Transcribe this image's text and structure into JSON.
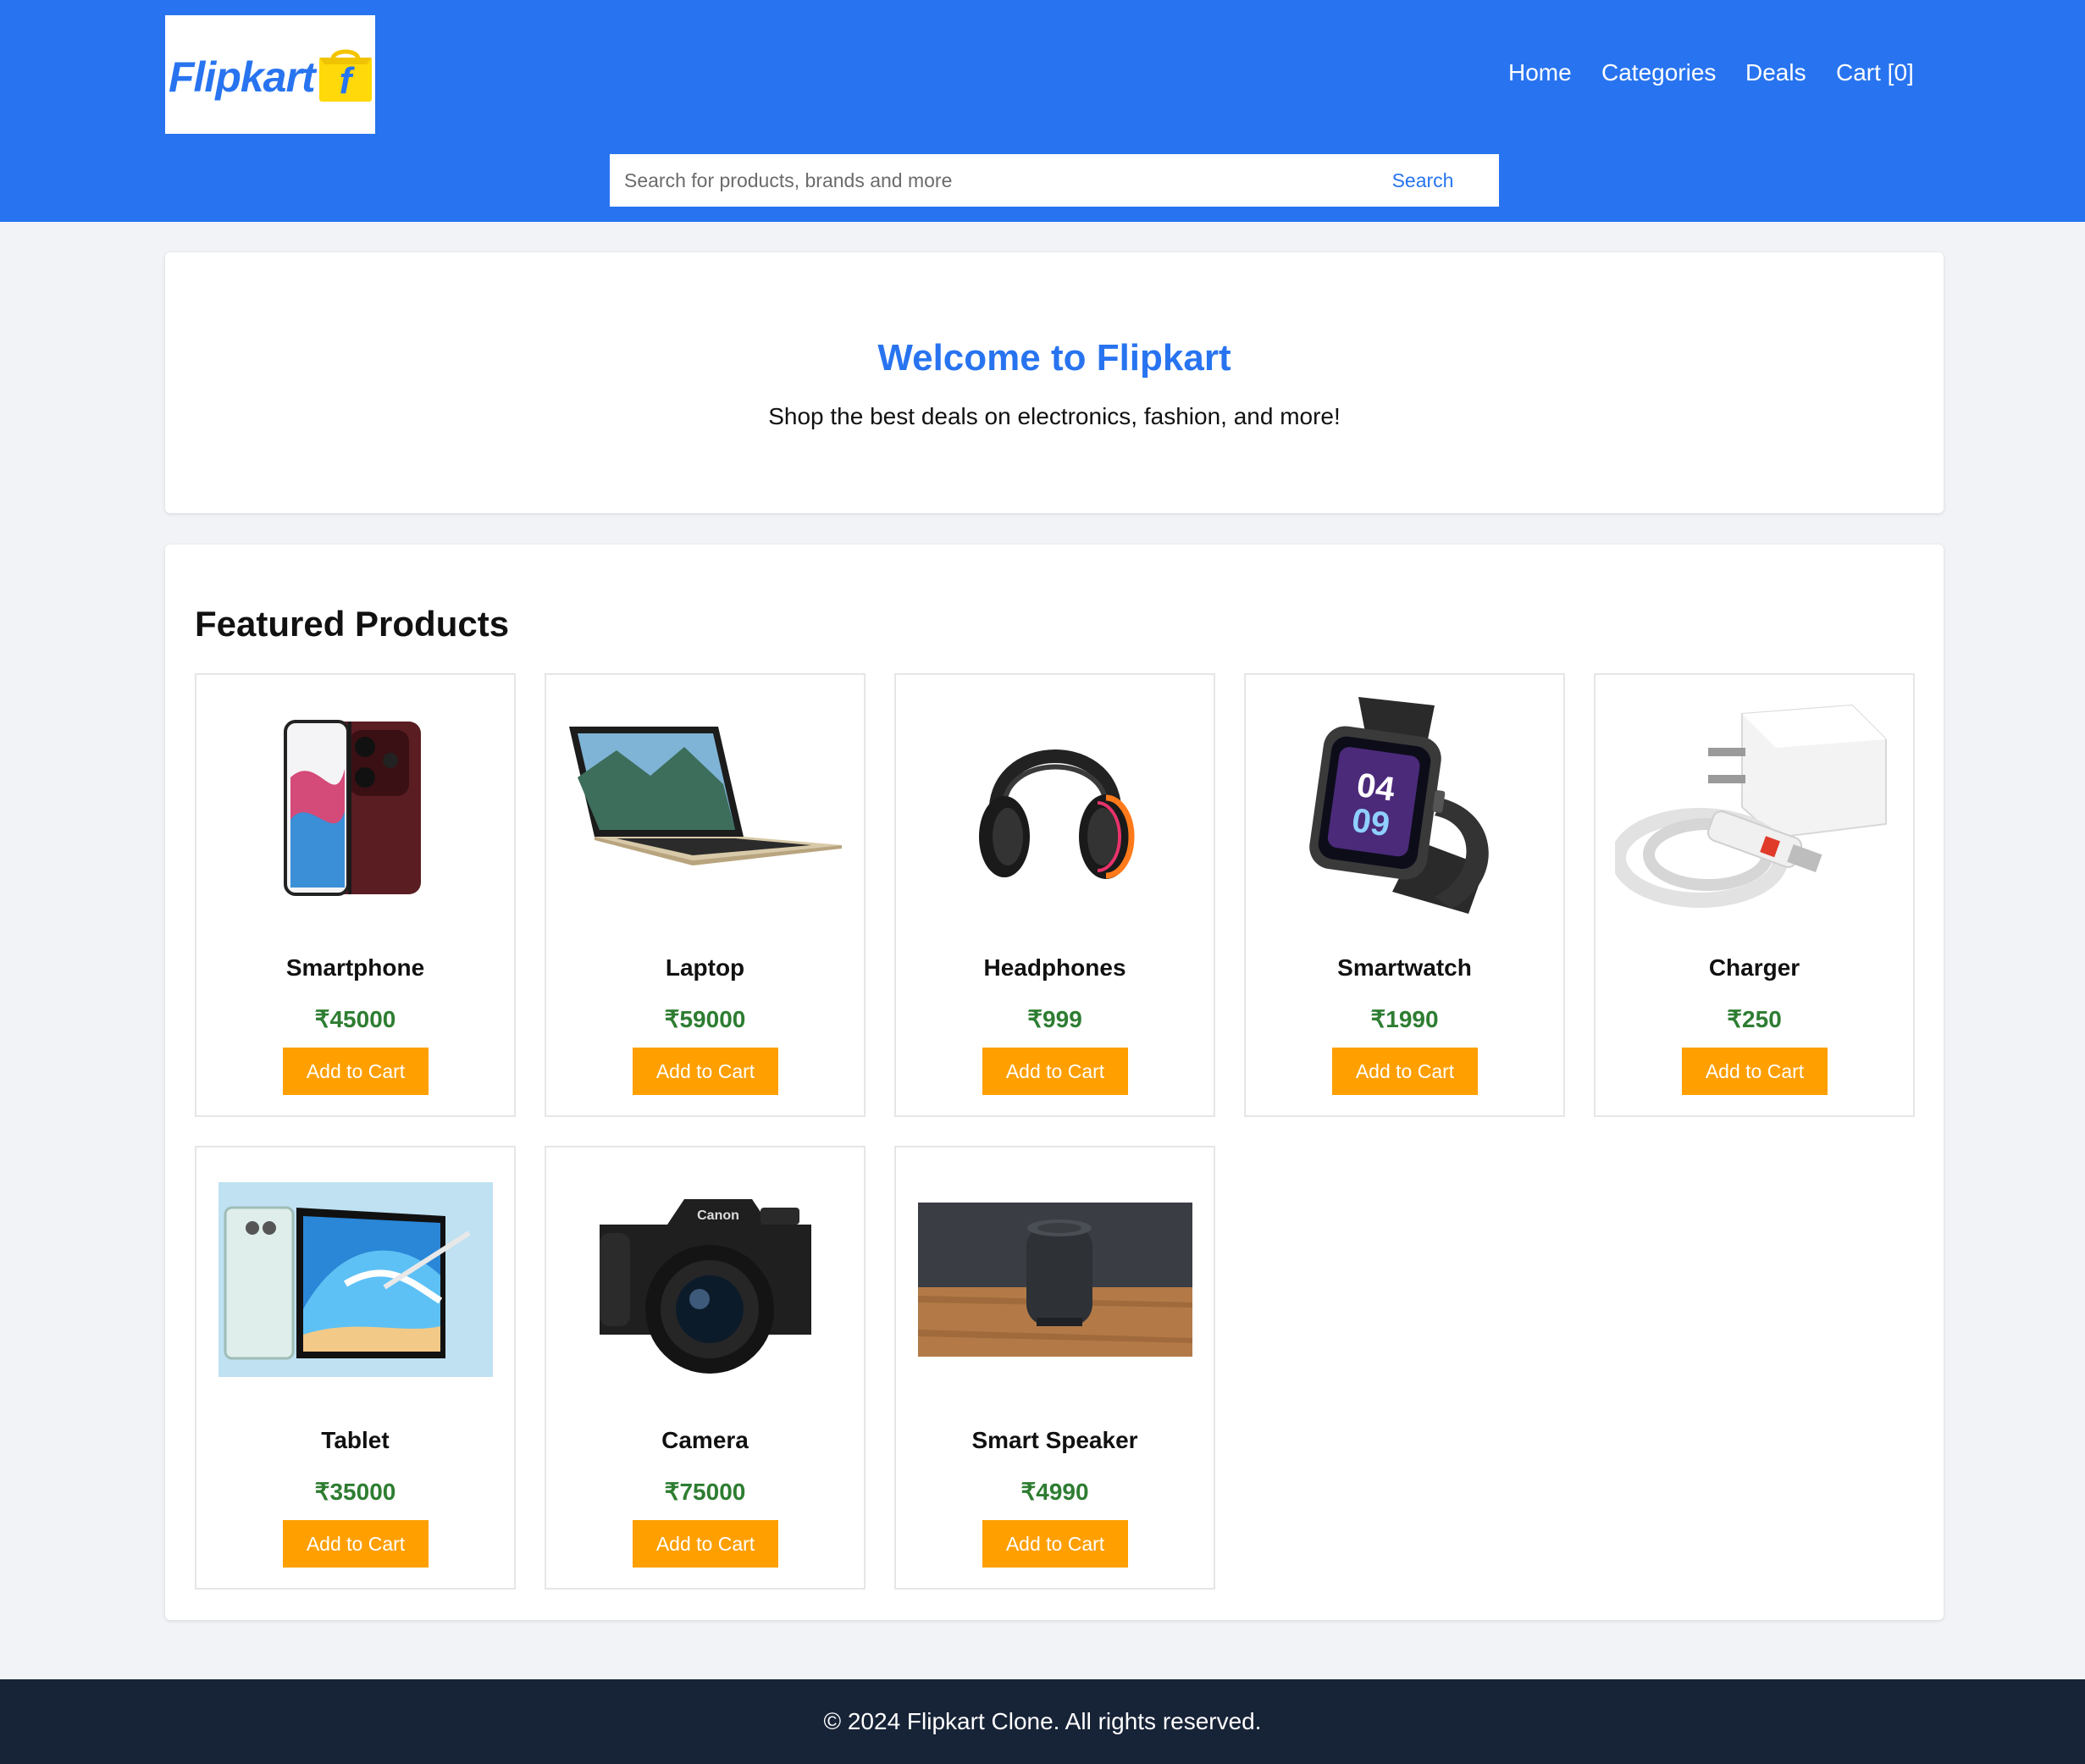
{
  "brand": {
    "logo_text": "Flipkart",
    "logo_mark": "f",
    "primary_color": "#2874f0",
    "accent_color": "#ff9f00",
    "price_color": "#2e7d32"
  },
  "nav": {
    "home": "Home",
    "categories": "Categories",
    "deals": "Deals",
    "cart": "Cart [0]"
  },
  "search": {
    "placeholder": "Search for products, brands and more",
    "value": "",
    "button": "Search"
  },
  "hero": {
    "title": "Welcome to Flipkart",
    "subtitle": "Shop the best deals on electronics, fashion, and more!"
  },
  "featured": {
    "heading": "Featured Products",
    "products": [
      {
        "name": "Smartphone",
        "price": "₹45000",
        "button": "Add to Cart",
        "image_icon": "smartphone-image"
      },
      {
        "name": "Laptop",
        "price": "₹59000",
        "button": "Add to Cart",
        "image_icon": "laptop-image"
      },
      {
        "name": "Headphones",
        "price": "₹999",
        "button": "Add to Cart",
        "image_icon": "headphones-image"
      },
      {
        "name": "Smartwatch",
        "price": "₹1990",
        "button": "Add to Cart",
        "image_icon": "smartwatch-image"
      },
      {
        "name": "Charger",
        "price": "₹250",
        "button": "Add to Cart",
        "image_icon": "charger-image"
      },
      {
        "name": "Tablet",
        "price": "₹35000",
        "button": "Add to Cart",
        "image_icon": "tablet-image"
      },
      {
        "name": "Camera",
        "price": "₹75000",
        "button": "Add to Cart",
        "image_icon": "camera-image"
      },
      {
        "name": "Smart Speaker",
        "price": "₹4990",
        "button": "Add to Cart",
        "image_icon": "smart-speaker-image"
      }
    ]
  },
  "footer": {
    "text": "© 2024 Flipkart Clone. All rights reserved."
  }
}
